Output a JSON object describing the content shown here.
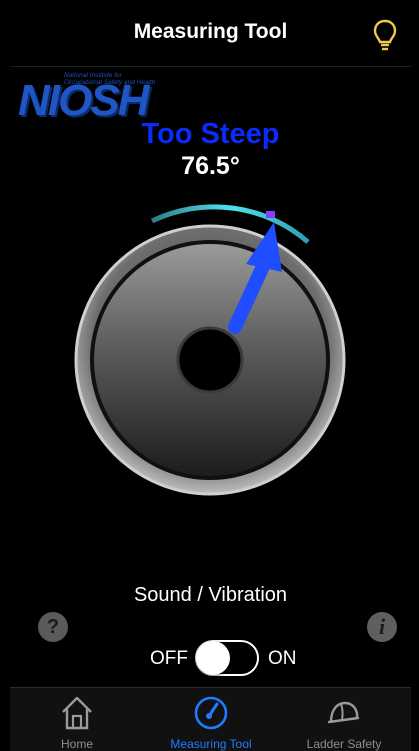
{
  "header": {
    "title": "Measuring Tool",
    "icon": "lightbulb-icon"
  },
  "logo": {
    "word": "NIOSH",
    "subtitle_line1": "National Institute for",
    "subtitle_line2": "Occupational Safety and Health"
  },
  "measurement": {
    "status": "Too Steep",
    "angle": "76.5°",
    "status_color": "#0a2bff"
  },
  "sound": {
    "label": "Sound / Vibration",
    "off_label": "OFF",
    "on_label": "ON",
    "state": "off"
  },
  "buttons": {
    "help_glyph": "?",
    "info_glyph": "i"
  },
  "tabs": [
    {
      "label": "Home",
      "icon": "home-icon",
      "active": false
    },
    {
      "label": "Measuring Tool",
      "icon": "gauge-icon",
      "active": true
    },
    {
      "label": "Ladder Safety",
      "icon": "hardhat-icon",
      "active": false
    }
  ],
  "colors": {
    "accent": "#1f7bff",
    "arrow": "#1f4dff",
    "zone_cyan": "#34d6e6",
    "zone_marker": "#8a3cff"
  }
}
